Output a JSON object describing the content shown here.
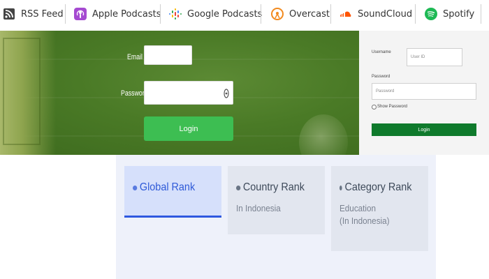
{
  "podcast_links": [
    {
      "label": "RSS Feed",
      "icon": "rss-icon"
    },
    {
      "label": "Apple Podcasts",
      "icon": "apple-podcasts-icon"
    },
    {
      "label": "Google Podcasts",
      "icon": "google-podcasts-icon"
    },
    {
      "label": "Overcast",
      "icon": "overcast-icon"
    },
    {
      "label": "SoundCloud",
      "icon": "soundcloud-icon"
    },
    {
      "label": "Spotify",
      "icon": "spotify-icon"
    }
  ],
  "hero_login": {
    "email_label": "Email",
    "email_value": "",
    "password_label": "Password",
    "password_value": "",
    "login_button": "Login"
  },
  "side_login": {
    "username_label": "Username",
    "username_placeholder": "User ID",
    "password_label": "Password",
    "password_placeholder": "Password",
    "show_password_label": "Show Password",
    "login_button": "Login"
  },
  "ranks": [
    {
      "title": "Global Rank",
      "subtitle": "",
      "active": true
    },
    {
      "title": "Country Rank",
      "subtitle": "In Indonesia",
      "active": false
    },
    {
      "title": "Category Rank",
      "subtitle": "Education",
      "subtitle2": "(In Indonesia)",
      "active": false
    }
  ],
  "colors": {
    "hero_green": "#4a7a26",
    "hero_button": "#3dbe52",
    "panel_button": "#0f7a2c",
    "active_rank": "#2f5ad8",
    "rank_bg": "#eef1fa",
    "apple_purple": "#a54ad1",
    "overcast_orange": "#f28a1e",
    "soundcloud_orange": "#ff5500",
    "spotify_green": "#1db954"
  }
}
